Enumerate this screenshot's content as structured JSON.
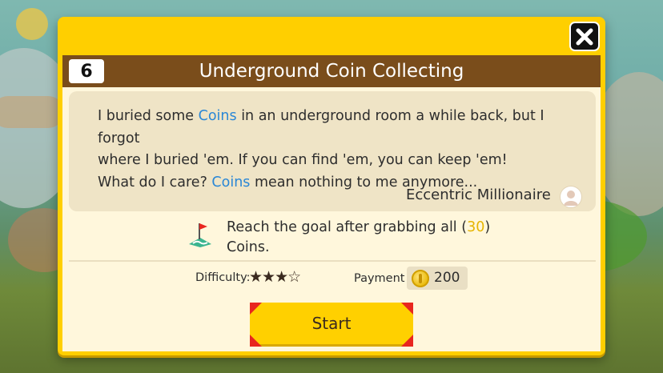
{
  "course": {
    "number": "6",
    "title": "Underground Coin Collecting"
  },
  "message": {
    "line1_a": "I buried some ",
    "line1_hl": "Coins",
    "line1_b": " in an underground room a while back, but I forgot",
    "line2": "where I buried 'em. If you can find 'em, you can keep 'em!",
    "line3_a": "What do I care? ",
    "line3_hl": "Coins",
    "line3_b": " mean nothing to me anymore...",
    "author": "Eccentric Millionaire"
  },
  "goal": {
    "icon": "goal-flag-icon",
    "text_a": "Reach the goal after grabbing all (",
    "count": "30",
    "text_b": ")",
    "text_line2": "Coins."
  },
  "difficulty": {
    "label": "Difficulty:",
    "rating": 3,
    "max": 5,
    "stars": "★★★☆"
  },
  "payment": {
    "label": "Payment",
    "amount": "200",
    "icon": "coin-icon"
  },
  "buttons": {
    "start_label": "Start",
    "close_icon": "close-icon"
  },
  "colors": {
    "frame": "#ffcf00",
    "title_bar": "#7a4d1b",
    "highlight": "#2a87d6",
    "coin_count": "#e6b400",
    "start_corners": "#e8261f"
  }
}
